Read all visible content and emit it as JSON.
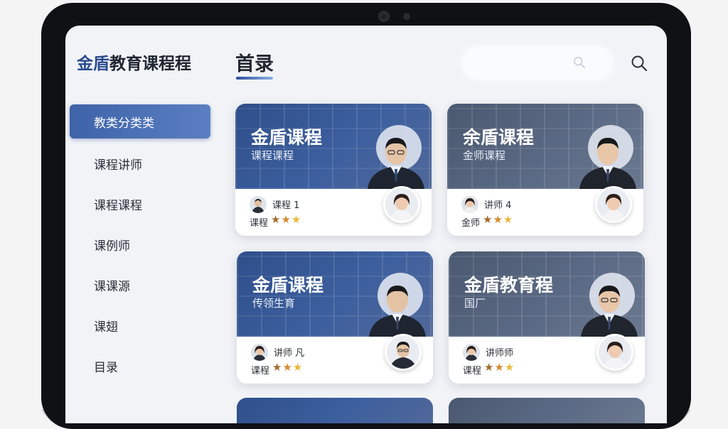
{
  "app": {
    "title_accent": "金盾",
    "title_rest": "教育课程程"
  },
  "sidebar": {
    "items": [
      {
        "label": "教类分类类",
        "active": true
      },
      {
        "label": "课程讲师",
        "active": false
      },
      {
        "label": "课程课程",
        "active": false
      },
      {
        "label": "课例师",
        "active": false
      },
      {
        "label": "课课源",
        "active": false
      },
      {
        "label": "课翅",
        "active": false
      },
      {
        "label": "目录",
        "active": false
      }
    ]
  },
  "header": {
    "title": "首录",
    "search_icon": "search-icon"
  },
  "cards": [
    {
      "title": "金盾课程",
      "subtitle": "课程课程",
      "teacher": "课程 1",
      "rating_label": "课程",
      "rating": 3,
      "theme": "blue"
    },
    {
      "title": "余盾课程",
      "subtitle": "金师课程",
      "teacher": "讲师 4",
      "rating_label": "金师",
      "rating": 3,
      "theme": "gray"
    },
    {
      "title": "金盾课程",
      "subtitle": "传领生育",
      "teacher": "讲师 凡",
      "rating_label": "课程",
      "rating": 3,
      "theme": "blue"
    },
    {
      "title": "金盾教育程",
      "subtitle": "国厂",
      "teacher": "讲师师",
      "rating_label": "课程",
      "rating": 3,
      "theme": "gray"
    }
  ],
  "colors": {
    "accent": "#2a4a8c",
    "active_nav": "#4a6db3",
    "star_bronze": "#a46a2c",
    "star_orange": "#d68a2e",
    "star_gold": "#e8b838"
  }
}
